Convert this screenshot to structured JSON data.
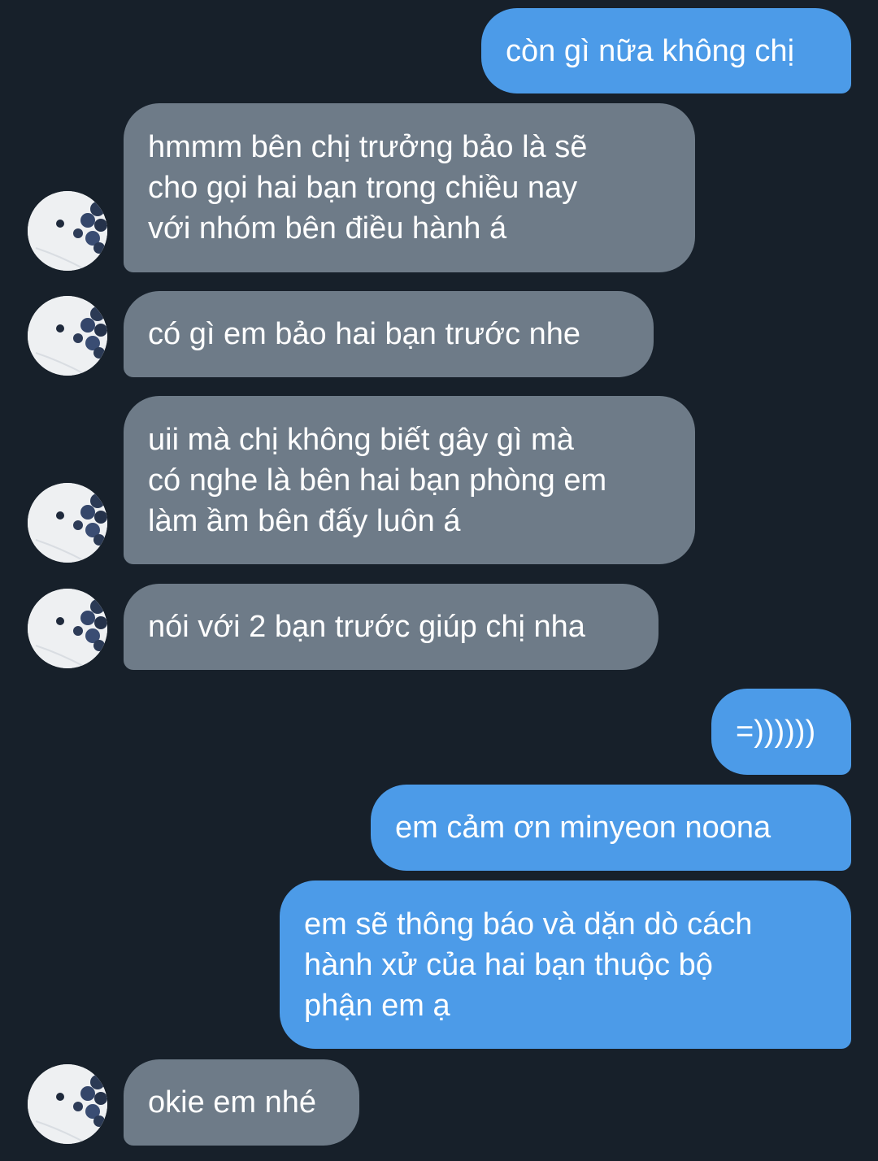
{
  "colors": {
    "background": "#17202a",
    "outgoing_bubble": "#4c9be8",
    "incoming_bubble": "#6e7b88",
    "text": "#ffffff"
  },
  "contact": {
    "avatar_icon": "blueberries-photo-avatar"
  },
  "messages": [
    {
      "direction": "outgoing",
      "text": "còn gì nữa không chị"
    },
    {
      "direction": "incoming",
      "text": "hmmm bên chị trưởng bảo là sẽ\ncho gọi hai bạn trong chiều nay\nvới nhóm bên điều hành á"
    },
    {
      "direction": "incoming",
      "text": "có gì em bảo hai bạn trước nhe"
    },
    {
      "direction": "incoming",
      "text": "uii mà chị không biết gây gì mà\ncó nghe là bên hai bạn phòng em\nlàm ầm bên đấy luôn á"
    },
    {
      "direction": "incoming",
      "text": "nói với 2 bạn trước giúp chị nha"
    },
    {
      "direction": "outgoing",
      "text": "=))))))"
    },
    {
      "direction": "outgoing",
      "text": "em cảm ơn minyeon noona"
    },
    {
      "direction": "outgoing",
      "text": "em sẽ thông báo và dặn dò cách\nhành xử của hai bạn thuộc bộ\nphận em ạ"
    },
    {
      "direction": "incoming",
      "text": "okie em nhé"
    }
  ]
}
